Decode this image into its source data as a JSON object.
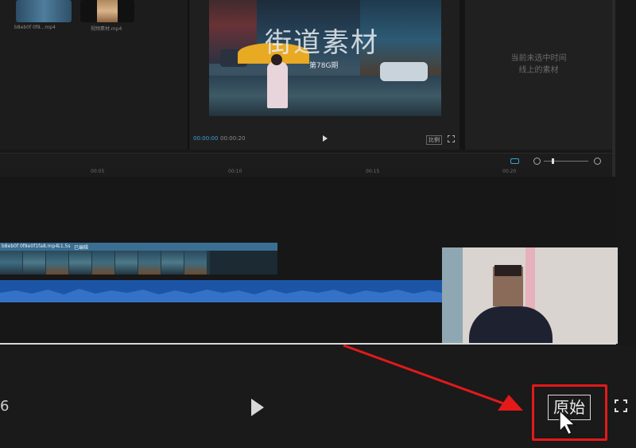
{
  "media_bin": {
    "items": [
      {
        "caption": "b8eb0f 0f8...mp4"
      },
      {
        "caption": "视频素材.mp4"
      }
    ]
  },
  "player": {
    "video_title": "街道素材",
    "video_subtitle": "第78G期",
    "current_time": "00:00:00",
    "total_time": "00:00:20",
    "ratio_label": "比例"
  },
  "properties_panel": {
    "empty_line1": "当前未选中时间",
    "empty_line2": "线上的素材"
  },
  "timeline": {
    "ruler_ticks": [
      "00:05",
      "00:10",
      "00:15",
      "00:20"
    ],
    "clip_name": "b8eb0f 0f8e0f1fa8.mp4",
    "clip_duration": "11.5s",
    "clip_tag": "已编辑"
  },
  "bottom_bar": {
    "left_digit": "6",
    "original_label": "原始"
  },
  "colors": {
    "annotation_red": "#e3191a",
    "clip_blue": "#3a6f93",
    "audio_blue": "#1d55a6",
    "accent_cyan": "#3aa0d8"
  }
}
